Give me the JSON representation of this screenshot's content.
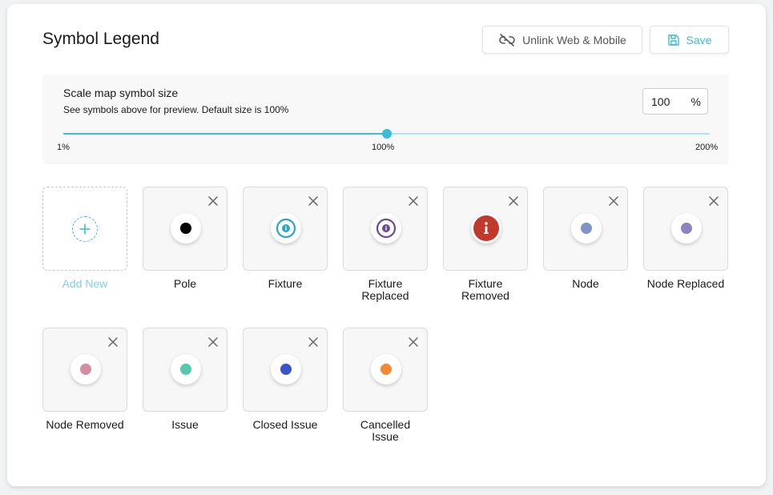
{
  "header": {
    "title": "Symbol Legend",
    "unlink_label": "Unlink Web & Mobile",
    "save_label": "Save"
  },
  "scale": {
    "title": "Scale map symbol size",
    "description": "See symbols above for preview. Default size is 100%",
    "value": "100",
    "unit": "%",
    "min_label": "1%",
    "mid_label": "100%",
    "max_label": "200%",
    "slider_fraction": 0.5
  },
  "add_new_label": "Add New",
  "symbols": [
    {
      "label": "Pole",
      "kind": "dot",
      "color": "#000000"
    },
    {
      "label": "Fixture",
      "kind": "info-ring",
      "color": "#2aa6c0"
    },
    {
      "label": "Fixture Replaced",
      "kind": "info-ring",
      "color": "#6a4c93"
    },
    {
      "label": "Fixture Removed",
      "kind": "info-filled",
      "color": "#c0392b"
    },
    {
      "label": "Node",
      "kind": "dot",
      "color": "#8094c4"
    },
    {
      "label": "Node Replaced",
      "kind": "dot",
      "color": "#8b84bf"
    },
    {
      "label": "Node Removed",
      "kind": "dot",
      "color": "#d38ea2"
    },
    {
      "label": "Issue",
      "kind": "dot",
      "color": "#55c9ae"
    },
    {
      "label": "Closed Issue",
      "kind": "dot",
      "color": "#3a55c6"
    },
    {
      "label": "Cancelled Issue",
      "kind": "dot",
      "color": "#f28a35"
    }
  ],
  "colors": {
    "accent": "#3bbcd9"
  }
}
